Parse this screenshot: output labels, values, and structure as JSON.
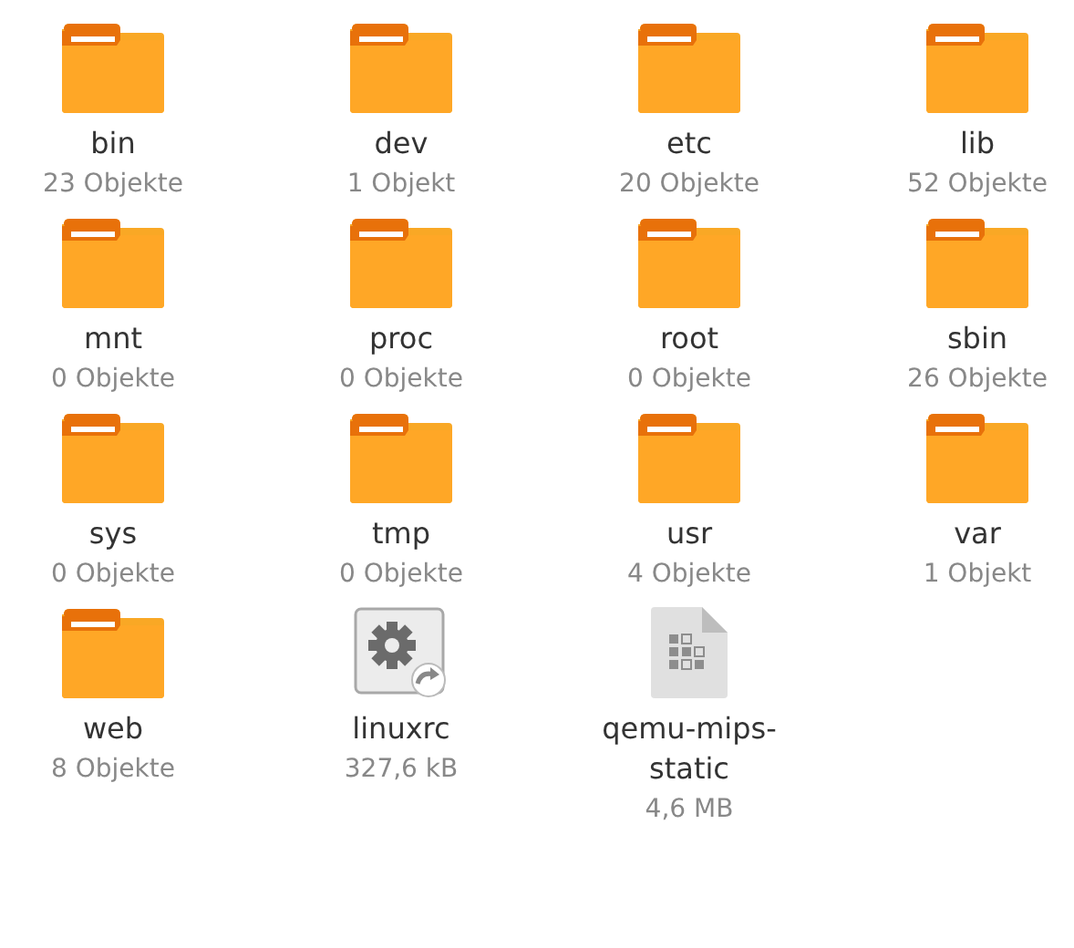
{
  "items": [
    {
      "kind": "folder",
      "name": "bin",
      "info": "23 Objekte"
    },
    {
      "kind": "folder",
      "name": "dev",
      "info": "1 Objekt"
    },
    {
      "kind": "folder",
      "name": "etc",
      "info": "20 Objekte"
    },
    {
      "kind": "folder",
      "name": "lib",
      "info": "52 Objekte"
    },
    {
      "kind": "folder",
      "name": "mnt",
      "info": "0 Objekte"
    },
    {
      "kind": "folder",
      "name": "proc",
      "info": "0 Objekte"
    },
    {
      "kind": "folder",
      "name": "root",
      "info": "0 Objekte"
    },
    {
      "kind": "folder",
      "name": "sbin",
      "info": "26 Objekte"
    },
    {
      "kind": "folder",
      "name": "sys",
      "info": "0 Objekte"
    },
    {
      "kind": "folder",
      "name": "tmp",
      "info": "0 Objekte"
    },
    {
      "kind": "folder",
      "name": "usr",
      "info": "4 Objekte"
    },
    {
      "kind": "folder",
      "name": "var",
      "info": "1 Objekt"
    },
    {
      "kind": "folder",
      "name": "web",
      "info": "8 Objekte"
    },
    {
      "kind": "script",
      "name": "linuxrc",
      "info": "327,6 kB"
    },
    {
      "kind": "binary",
      "name": "qemu-mips-static",
      "info": "4,6 MB"
    }
  ]
}
